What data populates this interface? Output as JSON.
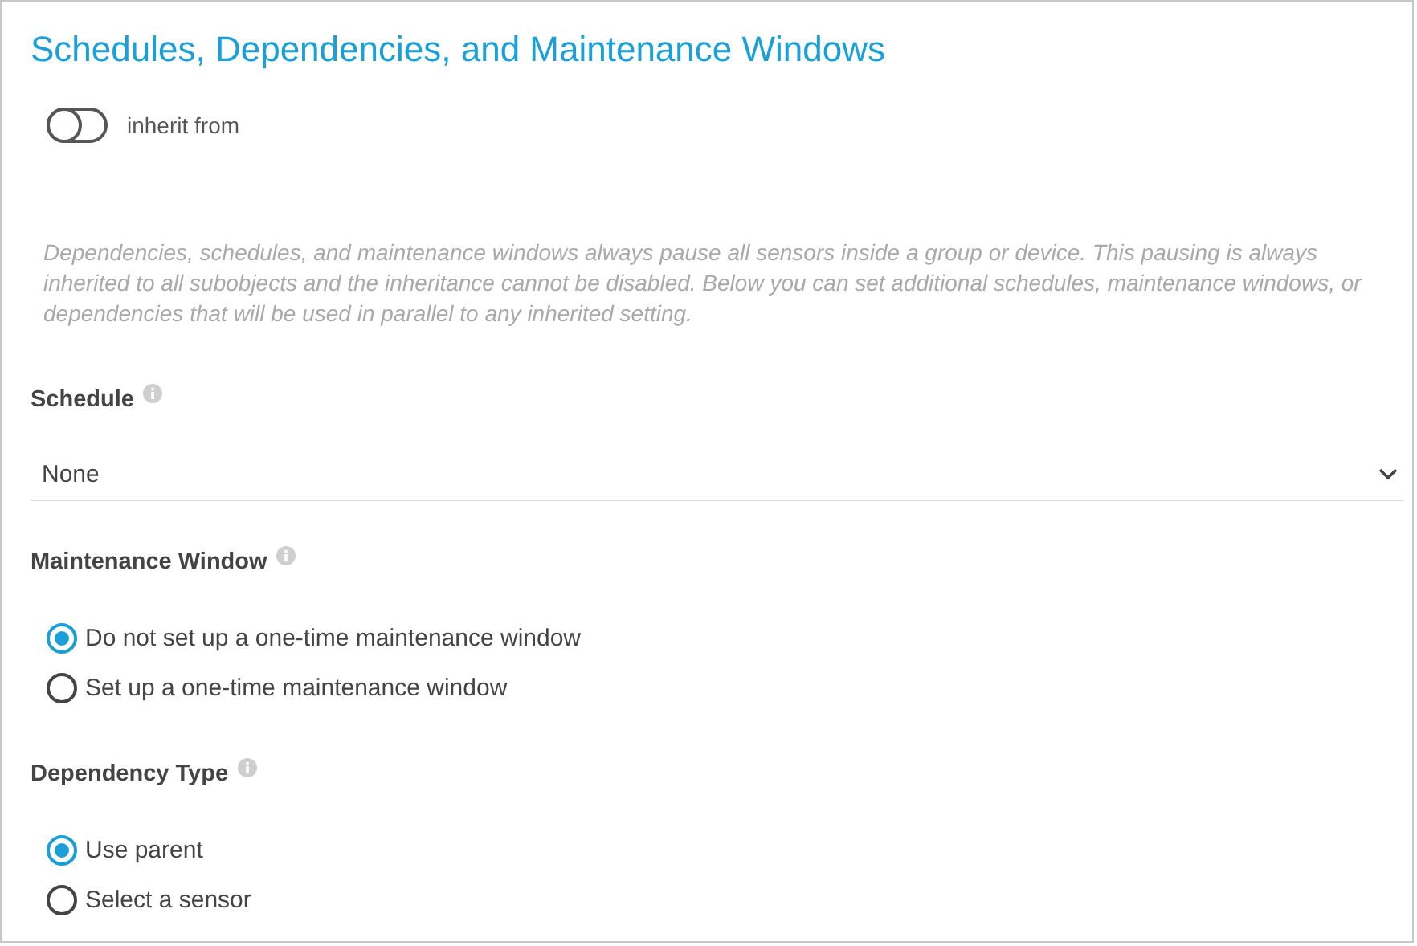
{
  "title": "Schedules, Dependencies, and Maintenance Windows",
  "inherit_toggle": {
    "label": "inherit from",
    "on": false
  },
  "description": "Dependencies, schedules, and maintenance windows always pause all sensors inside a group or device. This pausing is always inherited to all subobjects and the inheritance cannot be disabled. Below you can set additional schedules, maintenance windows, or dependencies that will be used in parallel to any inherited setting.",
  "sections": [
    {
      "kind": "select",
      "label": "Schedule",
      "value": "None"
    },
    {
      "kind": "radio",
      "label": "Maintenance Window",
      "options": [
        {
          "label": "Do not set up a one-time maintenance window",
          "selected": true
        },
        {
          "label": "Set up a one-time maintenance window",
          "selected": false
        }
      ]
    },
    {
      "kind": "radio",
      "label": "Dependency Type",
      "options": [
        {
          "label": "Use parent",
          "selected": true
        },
        {
          "label": "Select a sensor",
          "selected": false
        }
      ]
    }
  ]
}
